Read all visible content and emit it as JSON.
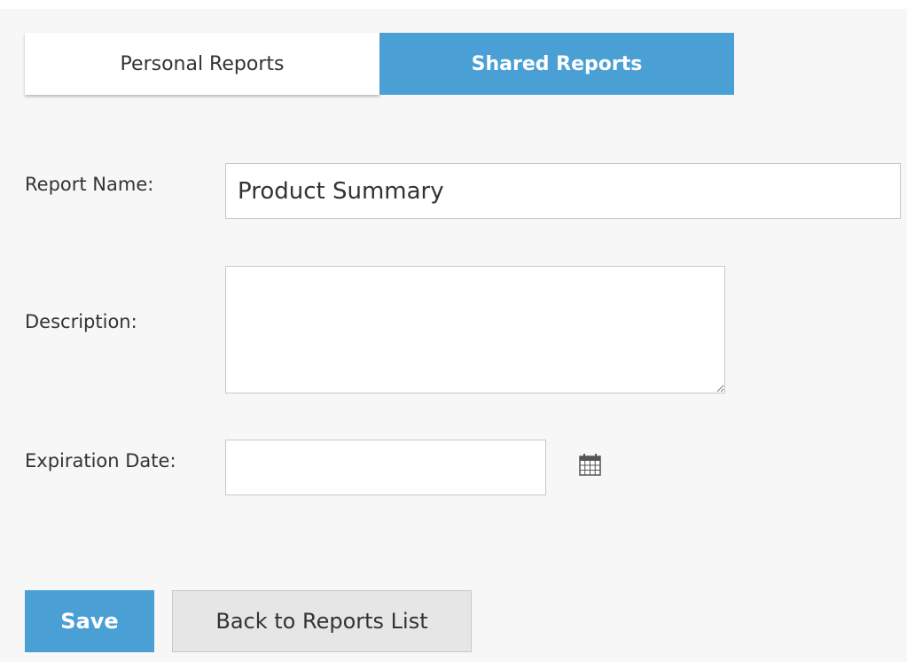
{
  "tabs": {
    "personal_label": "Personal Reports",
    "shared_label": "Shared Reports",
    "active": "Shared Reports"
  },
  "form": {
    "report_name_label": "Report Name:",
    "report_name_value": "Product Summary",
    "description_label": "Description:",
    "description_value": "",
    "expiration_label": "Expiration Date:",
    "expiration_value": ""
  },
  "buttons": {
    "save_label": "Save",
    "back_label": "Back to Reports List"
  },
  "icons": {
    "calendar": "calendar-icon"
  },
  "colors": {
    "accent": "#4a9fd5",
    "background": "#f7f7f7"
  }
}
